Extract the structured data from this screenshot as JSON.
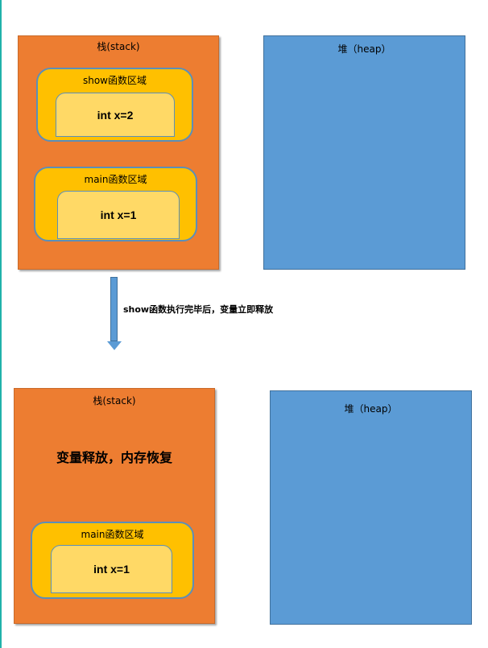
{
  "top": {
    "stack": {
      "title": "栈(stack)",
      "regions": [
        {
          "title": "show函数区域",
          "var": "int x=2"
        },
        {
          "title": "main函数区域",
          "var": "int x=1"
        }
      ]
    },
    "heap": {
      "title": "堆（heap）"
    }
  },
  "arrow": {
    "label": "show函数执行完毕后，变量立即释放"
  },
  "bottom": {
    "stack": {
      "title": "栈(stack)",
      "message": "变量释放，内存恢复",
      "regions": [
        {
          "title": "main函数区域",
          "var": "int x=1"
        }
      ]
    },
    "heap": {
      "title": "堆（heap）"
    }
  },
  "colors": {
    "stack": "#ed7d31",
    "heap": "#5b9bd5",
    "region": "#ffc000",
    "variable": "#ffd966",
    "arrow": "#5b9bd5"
  }
}
